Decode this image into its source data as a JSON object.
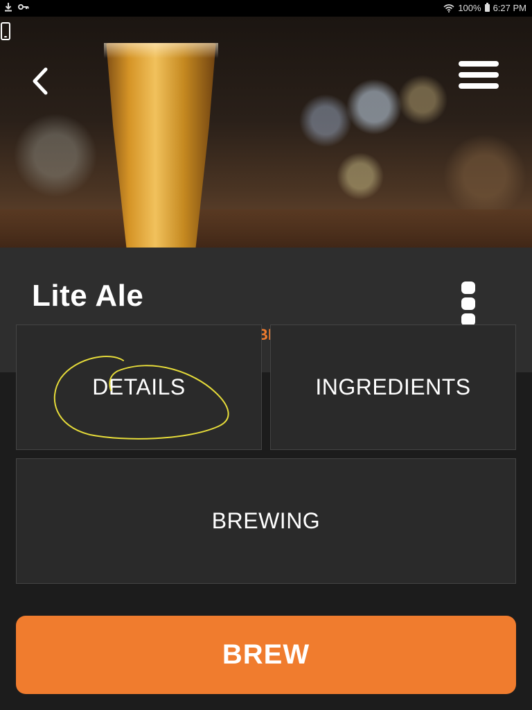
{
  "status_bar": {
    "battery": "100%",
    "time": "6:27 PM"
  },
  "beer": {
    "name": "Lite Ale",
    "peek_text": "BE"
  },
  "tiles": [
    {
      "label": "DETAILS"
    },
    {
      "label": "INGREDIENTS"
    },
    {
      "label": "BREWING"
    }
  ],
  "actions": {
    "brew_label": "BREW"
  },
  "colors": {
    "accent": "#f07c2e",
    "panel": "#2e2e2e",
    "tile": "#2a2a2a",
    "background": "#1c1c1c",
    "annotation": "#e6dc3a"
  },
  "icons": {
    "back": "chevron-left-icon",
    "menu": "hamburger-menu-icon",
    "more": "kebab-menu-icon",
    "download": "download-icon",
    "key": "key-icon",
    "wifi": "wifi-icon",
    "battery": "battery-icon",
    "device": "phone-icon"
  }
}
